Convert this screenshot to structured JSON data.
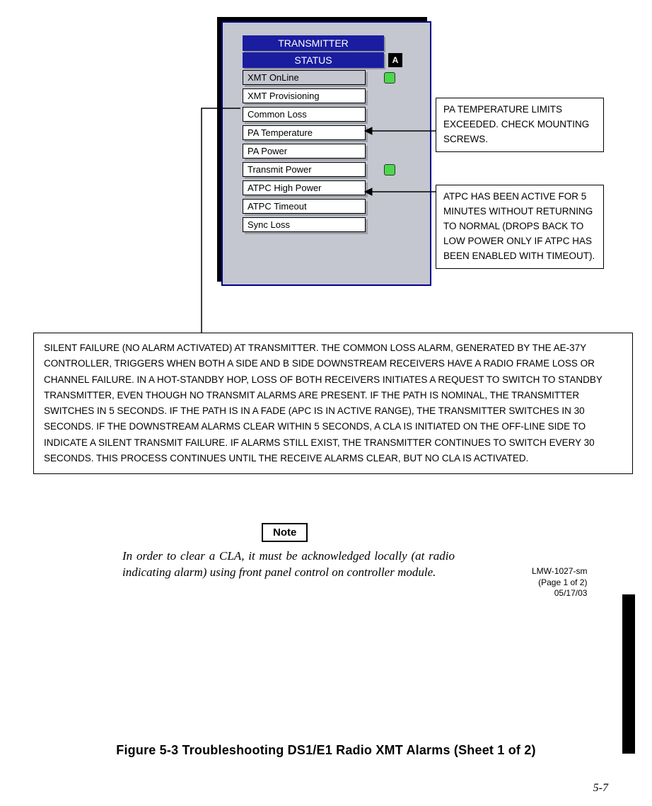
{
  "panel": {
    "title": "TRANSMITTER",
    "status_label": "STATUS",
    "ab_badge": "A",
    "items": [
      {
        "label": "XMT OnLine",
        "highlight": true,
        "led": "green"
      },
      {
        "label": "XMT Provisioning",
        "highlight": false,
        "led": null
      },
      {
        "label": "Common Loss",
        "highlight": false,
        "led": null
      },
      {
        "label": "PA Temperature",
        "highlight": false,
        "led": null
      },
      {
        "label": "PA Power",
        "highlight": false,
        "led": null
      },
      {
        "label": "Transmit Power",
        "highlight": false,
        "led": "green"
      },
      {
        "label": "ATPC High Power",
        "highlight": false,
        "led": null
      },
      {
        "label": "ATPC Timeout",
        "highlight": false,
        "led": null
      },
      {
        "label": "Sync Loss",
        "highlight": false,
        "led": null
      }
    ]
  },
  "callouts": {
    "patemp": "PA TEMPERATURE LIMITS EXCEEDED. CHECK MOUNTING SCREWS.",
    "atpc": "ATPC HAS BEEN ACTIVE FOR 5 MINUTES WITHOUT RETURNING TO NORMAL (DROPS BACK TO LOW POWER ONLY IF ATPC HAS BEEN ENABLED WITH TIMEOUT)."
  },
  "bigbox": "SILENT FAILURE (NO ALARM ACTIVATED) AT TRANSMITTER. THE COMMON LOSS ALARM, GENERATED BY THE AE-37Y CONTROLLER, TRIGGERS WHEN BOTH A SIDE AND B SIDE DOWNSTREAM RECEIVERS HAVE A RADIO FRAME LOSS OR CHANNEL FAILURE. IN A HOT-STANDBY HOP, LOSS OF BOTH RECEIVERS INITIATES A REQUEST TO SWITCH TO STANDBY TRANSMITTER, EVEN THOUGH NO TRANSMIT ALARMS ARE PRESENT. IF THE PATH IS NOMINAL, THE TRANSMITTER SWITCHES IN 5 SECONDS. IF THE PATH IS IN A FADE (APC IS IN ACTIVE RANGE), THE TRANSMITTER SWITCHES IN 30 SECONDS. IF THE DOWNSTREAM ALARMS CLEAR WITHIN 5 SECONDS, A CLA IS INITIATED ON THE OFF-LINE SIDE TO INDICATE A SILENT TRANSMIT FAILURE. IF ALARMS STILL EXIST, THE TRANSMITTER CONTINUES TO SWITCH EVERY 30 SECONDS. THIS PROCESS CONTINUES UNTIL THE RECEIVE ALARMS CLEAR, BUT NO CLA IS ACTIVATED.",
  "note": {
    "badge": "Note",
    "text": "In order to clear a CLA, it must be acknowledged locally (at radio indicating alarm) using front panel control on controller module."
  },
  "docref": {
    "line1": "LMW-1027-sm",
    "line2": "(Page 1 of 2)",
    "line3": "05/17/03"
  },
  "figcaption": "Figure 5-3  Troubleshooting DS1/E1 Radio XMT Alarms (Sheet 1 of 2)",
  "pagenum": "5-7"
}
